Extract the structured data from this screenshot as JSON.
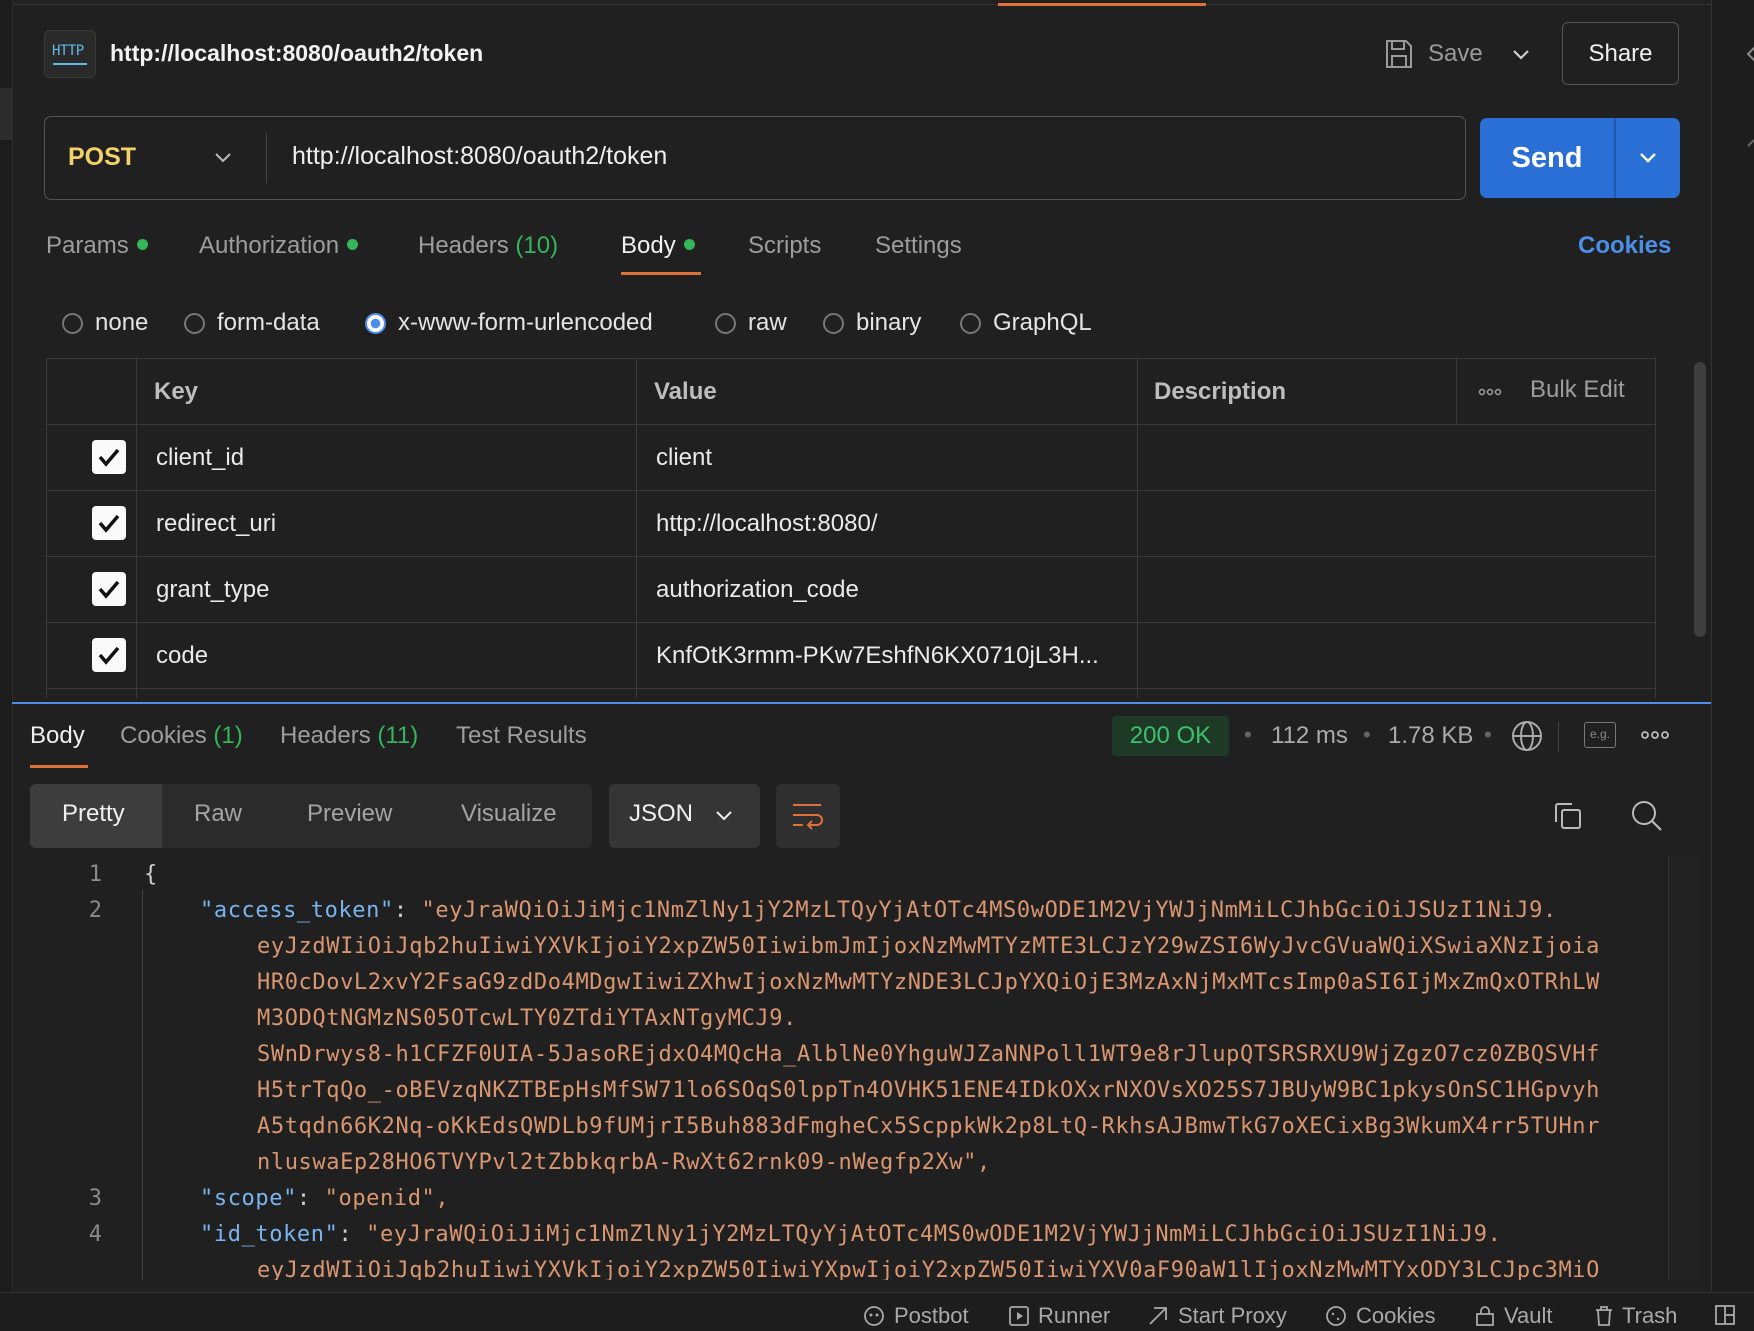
{
  "request": {
    "title": "http://localhost:8080/oauth2/token",
    "http_icon_label": "HTTP",
    "save_label": "Save",
    "share_label": "Share",
    "method": "POST",
    "url": "http://localhost:8080/oauth2/token",
    "send_label": "Send"
  },
  "request_tabs": {
    "params": "Params",
    "authorization": "Authorization",
    "headers": "Headers",
    "headers_count": "(10)",
    "body": "Body",
    "scripts": "Scripts",
    "settings": "Settings",
    "cookies": "Cookies"
  },
  "body_modes": {
    "none": "none",
    "form_data": "form-data",
    "urlencoded": "x-www-form-urlencoded",
    "raw": "raw",
    "binary": "binary",
    "graphql": "GraphQL",
    "selected": "x-www-form-urlencoded"
  },
  "params_table": {
    "headers": {
      "key": "Key",
      "value": "Value",
      "description": "Description",
      "bulk_edit": "Bulk Edit"
    },
    "rows": [
      {
        "key": "client_id",
        "value": "client",
        "checked": true
      },
      {
        "key": "redirect_uri",
        "value": "http://localhost:8080/",
        "checked": true
      },
      {
        "key": "grant_type",
        "value": "authorization_code",
        "checked": true
      },
      {
        "key": "code",
        "value": "KnfOtK3rmm-PKw7EshfN6KX0710jL3H...",
        "checked": true
      }
    ]
  },
  "response": {
    "tabs": {
      "body": "Body",
      "cookies": "Cookies",
      "cookies_count": "(1)",
      "headers": "Headers",
      "headers_count": "(11)",
      "test_results": "Test Results"
    },
    "status": "200 OK",
    "time": "112 ms",
    "size": "1.78 KB",
    "views": {
      "pretty": "Pretty",
      "raw": "Raw",
      "preview": "Preview",
      "visualize": "Visualize"
    },
    "format": "JSON",
    "eg_label": "e.g.",
    "code_lines": [
      {
        "n": "1",
        "text": "{"
      },
      {
        "n": "2",
        "key": "\"access_token\"",
        "val": "\"eyJraWQiOiJiMjc1NmZlNy1jY2MzLTQyYjAtOTc4MS0wODE1M2VjYWJjNmMiLCJhbGciOiJSUzI1NiJ9."
      },
      {
        "n": "",
        "val": "eyJzdWIiOiJqb2huIiwiYXVkIjoiY2xpZW50IiwibmJmIjoxNzMwMTYzMTE3LCJzY29wZSI6WyJvcGVuaWQiXSwiaXNzIjoia"
      },
      {
        "n": "",
        "val": "HR0cDovL2xvY2FsaG9zdDo4MDgwIiwiZXhwIjoxNzMwMTYzNDE3LCJpYXQiOjE3MzAxNjMxMTcsImp0aSI6IjMxZmQxOTRhLW"
      },
      {
        "n": "",
        "val": "M3ODQtNGMzNS05OTcwLTY0ZTdiYTAxNTgyMCJ9."
      },
      {
        "n": "",
        "val": "SWnDrwys8-h1CFZF0UIA-5JasoREjdxO4MQcHa_AlblNe0YhguWJZaNNPoll1WT9e8rJlupQTSRSRXU9WjZgzO7cz0ZBQSVHf"
      },
      {
        "n": "",
        "val": "H5trTqQo_-oBEVzqNKZTBEpHsMfSW71lo6SOqS0lppTn4OVHK51ENE4IDkOXxrNXOVsXO25S7JBUyW9BC1pkysOnSC1HGpvyh"
      },
      {
        "n": "",
        "val": "A5tqdn66K2Nq-oKkEdsQWDLb9fUMjrI5Buh883dFmgheCx5ScppkWk2p8LtQ-RkhsAJBmwTkG7oXECixBg3WkumX4rr5TUHnr"
      },
      {
        "n": "",
        "val": "nluswaEp28HO6TVYPvl2tZbbkqrbA-RwXt62rnk09-nWegfp2Xw\","
      },
      {
        "n": "3",
        "key": "\"scope\"",
        "val": "\"openid\","
      },
      {
        "n": "4",
        "key": "\"id_token\"",
        "val": "\"eyJraWQiOiJiMjc1NmZlNy1jY2MzLTQyYjAtOTc4MS0wODE1M2VjYWJjNmMiLCJhbGciOiJSUzI1NiJ9."
      },
      {
        "n": "",
        "val": "eyJzdWIiOiJqb2huIiwiYXVkIjoiY2xpZW50IiwiYXpwIjoiY2xpZW50IiwiYXV0aF90aW1lIjoxNzMwMTYxODY3LCJpc3MiO"
      }
    ]
  },
  "footer": {
    "postbot": "Postbot",
    "runner": "Runner",
    "start_proxy": "Start Proxy",
    "cookies": "Cookies",
    "vault": "Vault",
    "trash": "Trash"
  },
  "colors": {
    "accent": "#e0703a",
    "send": "#2a6fd6",
    "link": "#4c8ee8",
    "success": "#35b55a",
    "string": "#d99670",
    "key": "#79b4f0"
  }
}
